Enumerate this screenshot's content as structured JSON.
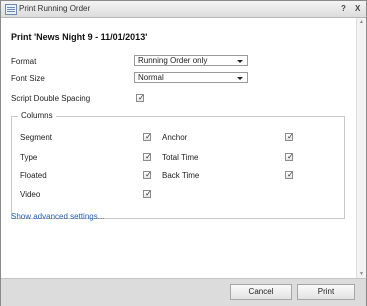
{
  "window": {
    "title": "Print Running Order",
    "help_label": "?",
    "close_label": "X"
  },
  "form": {
    "heading": "Print 'News Night 9 - 11/01/2013'",
    "format_label": "Format",
    "format_value": "Running Order only",
    "font_size_label": "Font Size",
    "font_size_value": "Normal",
    "script_double_spacing_label": "Script Double Spacing",
    "script_double_spacing_checked": true
  },
  "columns": {
    "legend": "Columns",
    "items": [
      {
        "label": "Segment",
        "checked": true
      },
      {
        "label": "Anchor",
        "checked": true
      },
      {
        "label": "Type",
        "checked": true
      },
      {
        "label": "Total Time",
        "checked": true
      },
      {
        "label": "Floated",
        "checked": true
      },
      {
        "label": "Back Time",
        "checked": true
      },
      {
        "label": "Video",
        "checked": true
      }
    ]
  },
  "advanced_link": "Show advanced settings...",
  "buttons": {
    "cancel": "Cancel",
    "print": "Print"
  },
  "icons": {
    "title": "dialog-window-icon",
    "check": "checkmark-icon",
    "dropdown": "chevron-down-icon",
    "scroll_up": "scroll-up-arrow-icon",
    "scroll_down": "scroll-down-arrow-icon"
  }
}
